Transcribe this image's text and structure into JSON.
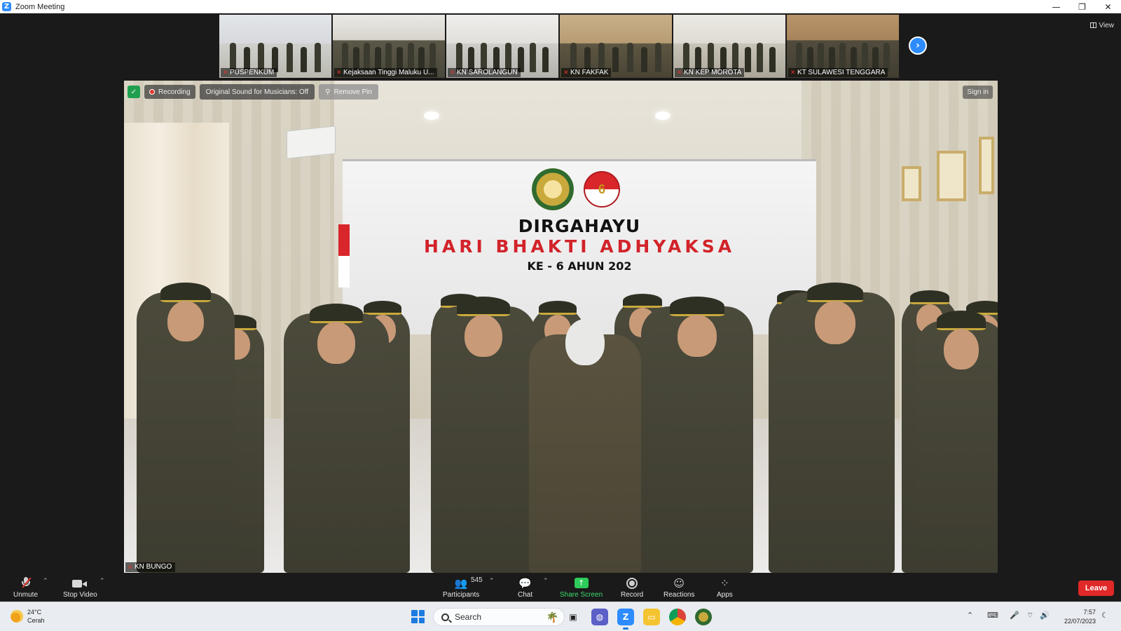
{
  "window": {
    "title": "Zoom Meeting",
    "controls": [
      "minimize",
      "restore",
      "close"
    ]
  },
  "view_button": {
    "label": "View",
    "icon": "grid-view-icon"
  },
  "thumbnails": [
    {
      "name": "PUSPENKUM"
    },
    {
      "name": "Kejaksaan Tinggi Maluku U..."
    },
    {
      "name": "KN SAROLANGUN"
    },
    {
      "name": "KN FAKFAK"
    },
    {
      "name": "KN KEP MOROTA"
    },
    {
      "name": "KT SULAWESI TENGGARA"
    }
  ],
  "main_video": {
    "participant_name": "KN BUNGO",
    "recording_label": "Recording",
    "original_sound_label": "Original Sound for Musicians: Off",
    "remove_pin_label": "Remove Pin",
    "sign_in_label": "Sign in",
    "banner": {
      "line1": "DIRGAHAYU",
      "line2": "HARI BHAKTI ADHYAKSA",
      "line3": "KE - 6  AHUN 202",
      "logo_number": "6"
    }
  },
  "toolbar": {
    "unmute": "Unmute",
    "stop_video": "Stop Video",
    "participants": "Participants",
    "participants_count": "545",
    "chat": "Chat",
    "share_screen": "Share Screen",
    "record": "Record",
    "reactions": "Reactions",
    "apps": "Apps",
    "leave": "Leave"
  },
  "taskbar": {
    "weather_temp": "24°C",
    "weather_desc": "Cerah",
    "search_placeholder": "Search",
    "time": "7:57",
    "date": "22/07/2023"
  },
  "colors": {
    "zoom_blue": "#2d8cff",
    "leave_red": "#e02828",
    "share_green": "#2ecc5a",
    "banner_red": "#d2232a"
  }
}
